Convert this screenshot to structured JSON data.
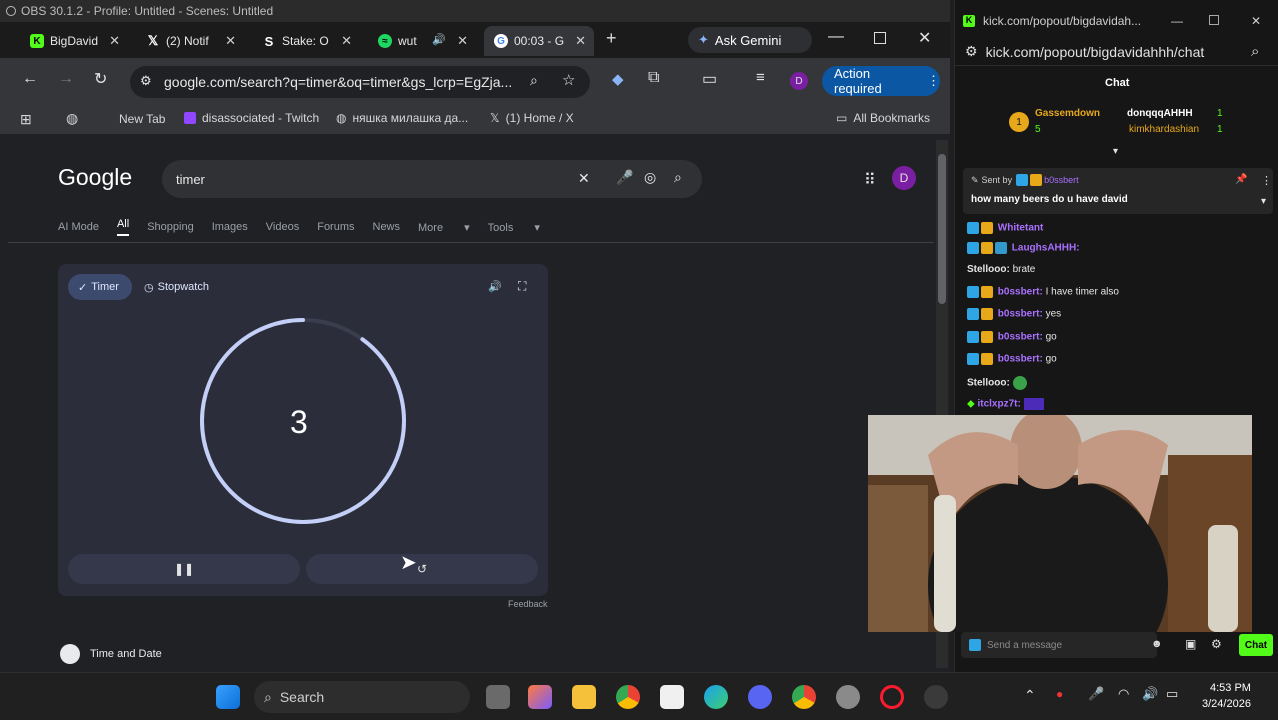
{
  "obs": {
    "title": "OBS 30.1.2 - Profile: Untitled - Scenes: Untitled"
  },
  "browser": {
    "tabs": [
      {
        "label": "BigDavid",
        "color": "#53fc18",
        "icon": "kick-icon"
      },
      {
        "label": "(2) Notif",
        "color": "#ffffff",
        "icon": "x-icon"
      },
      {
        "label": "Stake: O",
        "color": "#ffffff",
        "icon": "stake-icon"
      },
      {
        "label": "wut",
        "color": "#1ed760",
        "icon": "spotify-icon"
      },
      {
        "label": "00:03 - G",
        "color": "#ffffff",
        "icon": "google-icon"
      }
    ],
    "new_tab_glyph": "+",
    "ask_gemini": "Ask Gemini",
    "url": "google.com/search?q=timer&oq=timer&gs_lcrp=EgZja...",
    "profile_letter": "D",
    "action_required": "Action required",
    "bookmarks": [
      "New Tab",
      "disassociated - Twitch",
      "няшка милашка да...",
      "(1) Home / X"
    ],
    "all_bookmarks": "All Bookmarks"
  },
  "google": {
    "logo": "Google",
    "query": "timer",
    "profile_letter": "D",
    "nav": [
      "AI Mode",
      "All",
      "Shopping",
      "Images",
      "Videos",
      "Forums",
      "News",
      "More",
      "Tools"
    ],
    "nav_active": "All",
    "timer_tab": "Timer",
    "stopwatch_tab": "Stopwatch",
    "timer_value": "3",
    "progress_fraction": 0.9,
    "feedback": "Feedback",
    "result_title": "Time and Date"
  },
  "chat": {
    "window_url_short": "kick.com/popout/bigdavidah...",
    "url": "kick.com/popout/bigdavidahhh/chat",
    "header": "Chat",
    "leader": {
      "name": "Gassemdown",
      "count": "5",
      "top1": "donqqqAHHH",
      "top1_count": "1",
      "top2": "kimkhardashian",
      "top2_count": "1"
    },
    "pinned": {
      "sent_by": "Sent by",
      "user": "b0ssbert",
      "message": "how many beers do u have david"
    },
    "messages": [
      {
        "user": "Whitetant",
        "text": "",
        "color": "#a970ff"
      },
      {
        "user": "LaughsAHHH:",
        "text": "",
        "color": "#a970ff"
      },
      {
        "user": "Stellooo:",
        "text": "brate",
        "color": "#d8d8d8"
      },
      {
        "user": "b0ssbert:",
        "text": "I have timer also",
        "color": "#a970ff"
      },
      {
        "user": "b0ssbert:",
        "text": "yes",
        "color": "#a970ff"
      },
      {
        "user": "b0ssbert:",
        "text": "go",
        "color": "#a970ff"
      },
      {
        "user": "b0ssbert:",
        "text": "go",
        "color": "#a970ff"
      },
      {
        "user": "Stellooo:",
        "text": "",
        "color": "#d8d8d8"
      },
      {
        "user": "itclxpz7t:",
        "text": "",
        "color": "#a970ff"
      }
    ],
    "send_placeholder": "Send a message",
    "chat_button": "Chat"
  },
  "taskbar": {
    "search": "Search",
    "time": "4:53 PM",
    "date": "3/24/2026"
  },
  "colors": {
    "accent_green": "#53fc18",
    "timer_ring": "#c4cff7",
    "gemini_bg": "#2d2f33",
    "action_bg": "#0b57a4"
  }
}
